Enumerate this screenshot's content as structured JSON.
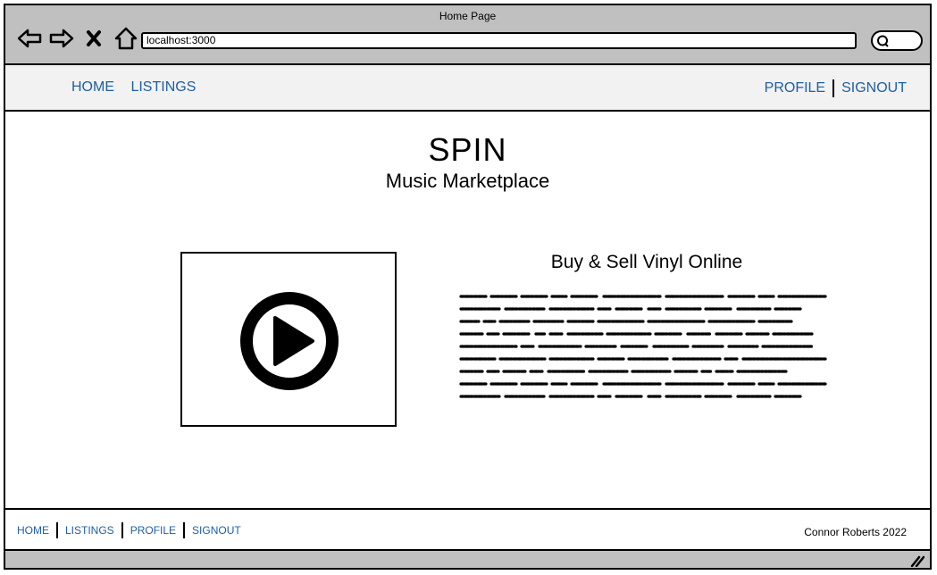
{
  "browser": {
    "title": "Home Page",
    "url": "localhost:3000",
    "icons": [
      "back-arrow-icon",
      "forward-arrow-icon",
      "close-icon",
      "home-icon",
      "search-icon",
      "resize-grip-icon"
    ]
  },
  "topnav": {
    "home": "HOME",
    "listings": "LISTINGS",
    "profile": "PROFILE",
    "signout": "SIGNOUT"
  },
  "hero": {
    "title": "SPIN",
    "subtitle": "Music Marketplace"
  },
  "section": {
    "heading": "Buy & Sell Vinyl Online",
    "video_icon": "play-icon"
  },
  "footer": {
    "home": "HOME",
    "listings": "LISTINGS",
    "profile": "PROFILE",
    "signout": "SIGNOUT",
    "copyright": "Connor Roberts 2022"
  },
  "colors": {
    "chrome": "#c0c0c0",
    "nav_bg": "#f2f2f2",
    "link": "#1f5fa0"
  }
}
